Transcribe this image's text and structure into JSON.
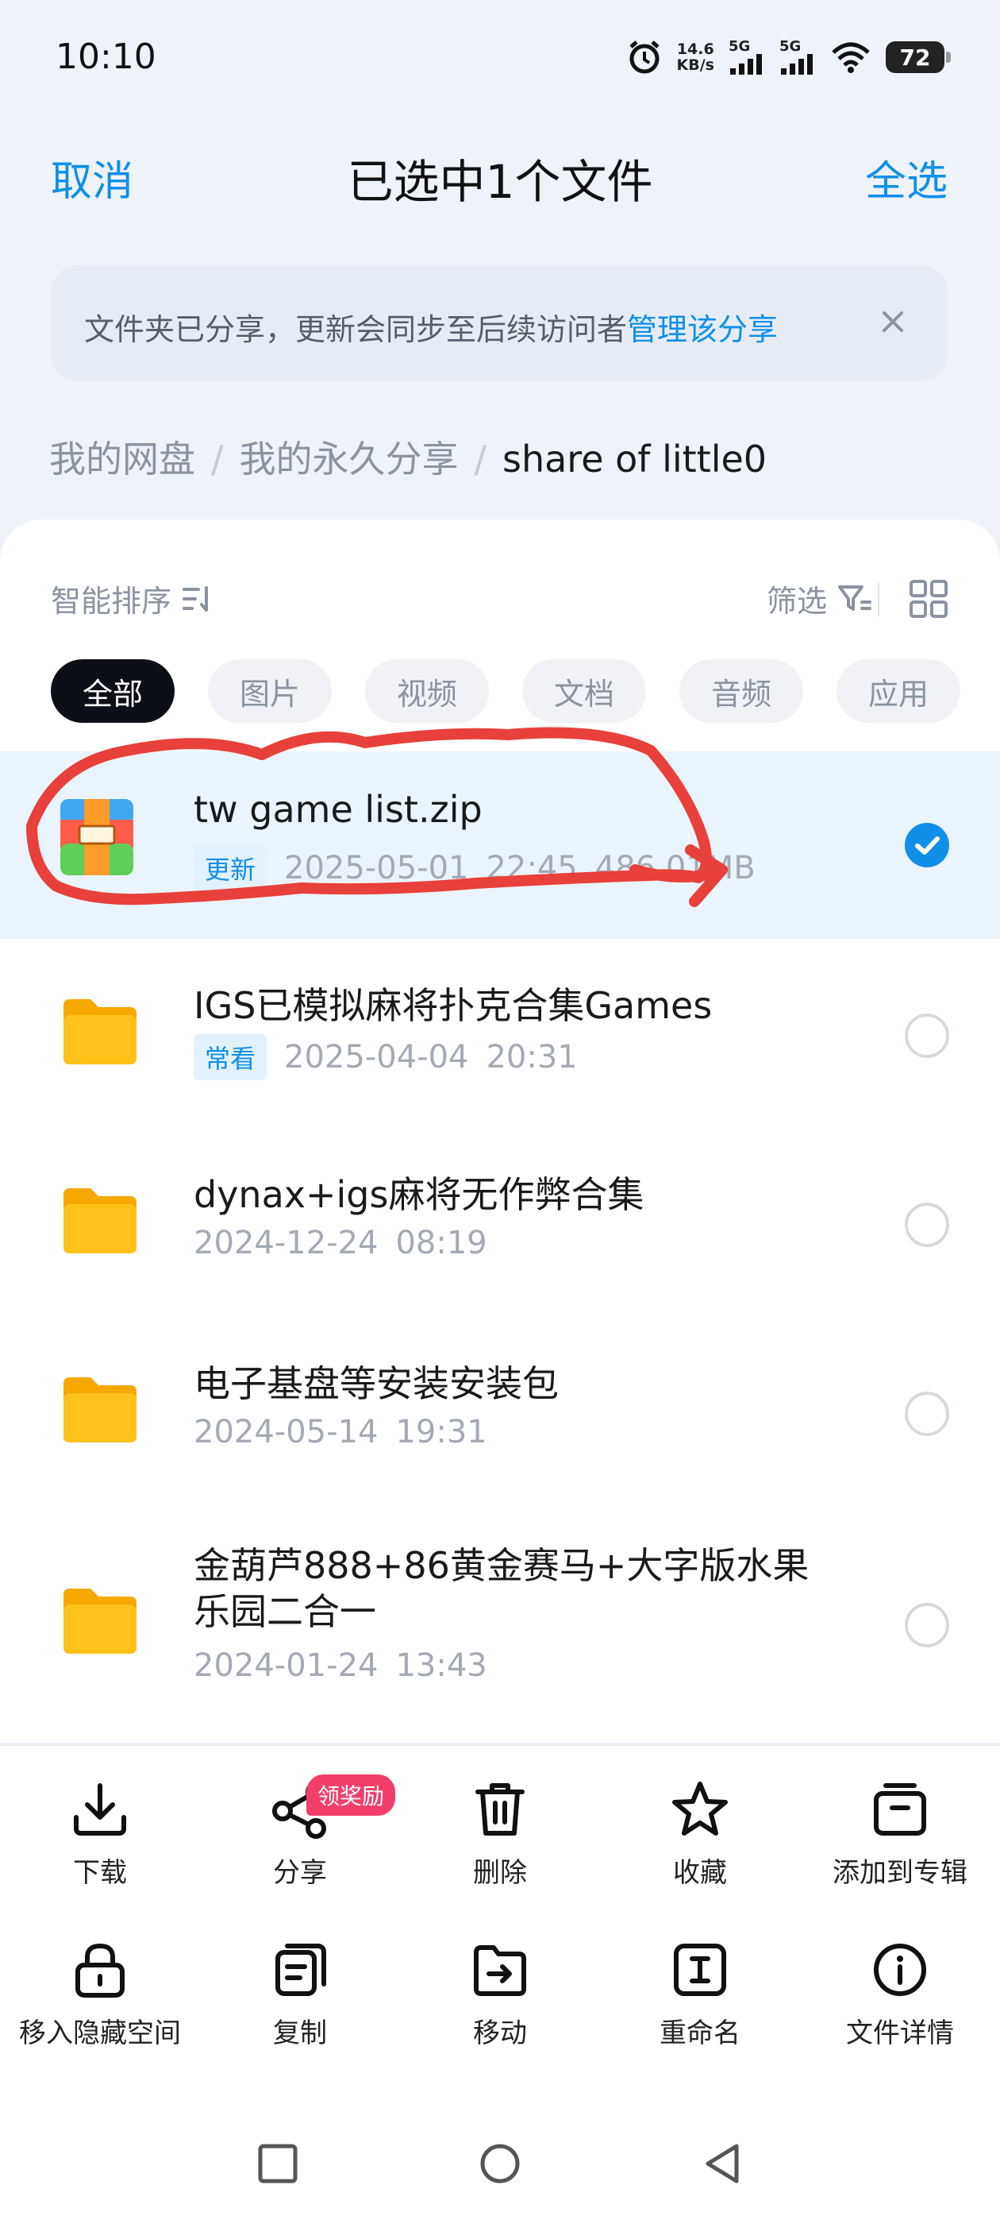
{
  "status_bar": {
    "time": "10:10",
    "net_speed_value": "14.6",
    "net_speed_unit": "KB/s",
    "sim1_label": "5G",
    "sim2_label": "5G",
    "battery": "72"
  },
  "header": {
    "cancel_label": "取消",
    "title": "已选中1个文件",
    "select_all_label": "全选"
  },
  "banner": {
    "text": "文件夹已分享，更新会同步至后续访问者",
    "link": "管理该分享"
  },
  "breadcrumb": {
    "items": [
      "我的网盘",
      "我的永久分享",
      "share of little0"
    ],
    "separator": "/"
  },
  "toolbar": {
    "sort_label": "智能排序",
    "filter_label": "筛选"
  },
  "chips": [
    "全部",
    "图片",
    "视频",
    "文档",
    "音频",
    "应用"
  ],
  "files": [
    {
      "name": "tw game list.zip",
      "tag": "更新",
      "date": "2025-05-01",
      "time": "22:45",
      "size": "486.01MB",
      "selected": true
    },
    {
      "name": "IGS已模拟麻将扑克合集Games",
      "tag": "常看",
      "date": "2025-04-04",
      "time": "20:31",
      "size": "",
      "selected": false
    },
    {
      "name": "dynax+igs麻将无作弊合集",
      "tag": "",
      "date": "2024-12-24",
      "time": "08:19",
      "size": "",
      "selected": false
    },
    {
      "name": "电子基盘等安装安装包",
      "tag": "",
      "date": "2024-05-14",
      "time": "19:31",
      "size": "",
      "selected": false
    },
    {
      "name_line1": "金葫芦888+86黄金赛马+大字版水果",
      "name_line2": "乐园二合一",
      "tag": "",
      "date": "2024-01-24",
      "time": "13:43",
      "size": "",
      "selected": false
    }
  ],
  "actions": {
    "download": "下载",
    "share": "分享",
    "share_badge": "领奖励",
    "delete": "删除",
    "favorite": "收藏",
    "add_album": "添加到专辑",
    "hide": "移入隐藏空间",
    "copy": "复制",
    "move": "移动",
    "rename": "重命名",
    "details": "文件详情"
  },
  "colors": {
    "accent": "#0f8fe8",
    "folder": "#ffc21a",
    "annotation": "#e8403a",
    "badge": "#f23f6a"
  }
}
